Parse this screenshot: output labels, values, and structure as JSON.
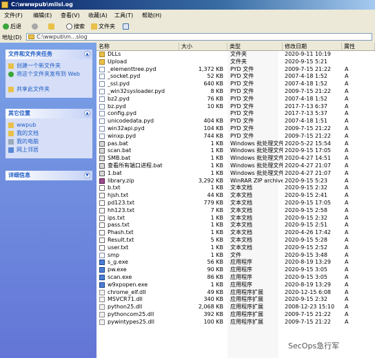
{
  "window": {
    "title": "C:\\wwwpub\\miisl.og"
  },
  "menu": [
    "文件(F)",
    "编辑(E)",
    "查看(V)",
    "收藏(A)",
    "工具(T)",
    "帮助(H)"
  ],
  "toolbar": {
    "back": "后退",
    "search": "搜索",
    "folders": "文件夹"
  },
  "address": {
    "label": "地址(D)",
    "value": "C:\\wwpub\\m...slog"
  },
  "left": {
    "tasks": {
      "title": "文件和文件夹任务",
      "items": [
        "创建一个新文件夹",
        "将这个文件夹发布到 Web",
        "共享此文件夹"
      ]
    },
    "places": {
      "title": "其它位置",
      "items": [
        "wwpub",
        "我的文档",
        "我的电脑",
        "网上邻居"
      ]
    },
    "details": {
      "title": "详细信息"
    }
  },
  "columns": [
    "名称",
    "大小",
    "类型",
    "修改日期",
    "属性"
  ],
  "files": [
    {
      "name": "DLLs",
      "size": "",
      "type": "文件夹",
      "date": "2020-9-11 10:19",
      "attr": "",
      "icon": "folder"
    },
    {
      "name": "Upload",
      "size": "",
      "type": "文件夹",
      "date": "2020-9-15 5:21",
      "attr": "",
      "icon": "folder"
    },
    {
      "name": "_elementtree.pyd",
      "size": "1,372 KB",
      "type": "PYD 文件",
      "date": "2009-7-15 21:22",
      "attr": "A",
      "icon": "file"
    },
    {
      "name": "_socket.pyd",
      "size": "52 KB",
      "type": "PYD 文件",
      "date": "2007-4-18 1:52",
      "attr": "A",
      "icon": "file"
    },
    {
      "name": "_ssl.pyd",
      "size": "640 KB",
      "type": "PYD 文件",
      "date": "2007-4-18 1:52",
      "attr": "A",
      "icon": "file"
    },
    {
      "name": "_win32sysloader.pyd",
      "size": "8 KB",
      "type": "PYD 文件",
      "date": "2009-7-15 21:22",
      "attr": "A",
      "icon": "file"
    },
    {
      "name": "bz2.pyd",
      "size": "76 KB",
      "type": "PYD 文件",
      "date": "2007-4-18 1:52",
      "attr": "A",
      "icon": "file"
    },
    {
      "name": "bz.pyd",
      "size": "10 KB",
      "type": "PYD 文件",
      "date": "2017-7-13 6:37",
      "attr": "A",
      "icon": "file"
    },
    {
      "name": "config.pyd",
      "size": "",
      "type": "PYD 文件",
      "date": "2017-7-13 5:37",
      "attr": "A",
      "icon": "file"
    },
    {
      "name": "unicodedata.pyd",
      "size": "404 KB",
      "type": "PYD 文件",
      "date": "2007-4-18 1:51",
      "attr": "A",
      "icon": "file"
    },
    {
      "name": "win32api.pyd",
      "size": "104 KB",
      "type": "PYD 文件",
      "date": "2009-7-15 21:22",
      "attr": "A",
      "icon": "file"
    },
    {
      "name": "winxp.pyd",
      "size": "744 KB",
      "type": "PYD 文件",
      "date": "2009-7-15 21:22",
      "attr": "A",
      "icon": "file"
    },
    {
      "name": "pas.bat",
      "size": "1 KB",
      "type": "Windows 批处理文件",
      "date": "2020-5-22 15:54",
      "attr": "A",
      "icon": "bat"
    },
    {
      "name": "scan.bat",
      "size": "1 KB",
      "type": "Windows 批处理文件",
      "date": "2020-9-15 17:05",
      "attr": "A",
      "icon": "bat"
    },
    {
      "name": "SMB.bat",
      "size": "1 KB",
      "type": "Windows 批处理文件",
      "date": "2020-4-27 14:51",
      "attr": "A",
      "icon": "bat"
    },
    {
      "name": "查看所有端口进程.bat",
      "size": "1 KB",
      "type": "Windows 批处理文件",
      "date": "2020-4-27 21:07",
      "attr": "A",
      "icon": "bat"
    },
    {
      "name": "1.bat",
      "size": "1 KB",
      "type": "Windows 批处理文件",
      "date": "2020-4-27 21:07",
      "attr": "A",
      "icon": "bat"
    },
    {
      "name": "library.zip",
      "size": "3,292 KB",
      "type": "WinRAR ZIP archive",
      "date": "2020-9-15 5:23",
      "attr": "A",
      "icon": "rar"
    },
    {
      "name": "b.txt",
      "size": "1 KB",
      "type": "文本文档",
      "date": "2020-9-15 2:32",
      "attr": "A",
      "icon": "txt"
    },
    {
      "name": "hjsh.txt",
      "size": "44 KB",
      "type": "文本文档",
      "date": "2020-9-15 2:41",
      "attr": "A",
      "icon": "txt"
    },
    {
      "name": "pd123.txt",
      "size": "779 KB",
      "type": "文本文档",
      "date": "2020-9-15 17:05",
      "attr": "A",
      "icon": "txt"
    },
    {
      "name": "hh123.txt",
      "size": "7 KB",
      "type": "文本文档",
      "date": "2020-9-15 2:58",
      "attr": "A",
      "icon": "txt"
    },
    {
      "name": "ips.txt",
      "size": "1 KB",
      "type": "文本文档",
      "date": "2020-9-15 2:32",
      "attr": "A",
      "icon": "txt"
    },
    {
      "name": "pass.txt",
      "size": "1 KB",
      "type": "文本文档",
      "date": "2020-9-15 2:51",
      "attr": "A",
      "icon": "txt"
    },
    {
      "name": "Phash.txt",
      "size": "1 KB",
      "type": "文本文档",
      "date": "2020-4-26 17:42",
      "attr": "A",
      "icon": "txt"
    },
    {
      "name": "Result.txt",
      "size": "5 KB",
      "type": "文本文档",
      "date": "2020-9-15 5:28",
      "attr": "A",
      "icon": "txt"
    },
    {
      "name": "user.txt",
      "size": "1 KB",
      "type": "文本文档",
      "date": "2020-9-15 2:52",
      "attr": "A",
      "icon": "txt"
    },
    {
      "name": "smp",
      "size": "1 KB",
      "type": "文件",
      "date": "2020-9-15 3:48",
      "attr": "A",
      "icon": "file"
    },
    {
      "name": "s_g.exe",
      "size": "56 KB",
      "type": "应用程序",
      "date": "2020-8-19 13:29",
      "attr": "A",
      "icon": "exe"
    },
    {
      "name": "pw.exe",
      "size": "90 KB",
      "type": "应用程序",
      "date": "2020-9-15 3:05",
      "attr": "A",
      "icon": "exe"
    },
    {
      "name": "scan.exe",
      "size": "86 KB",
      "type": "应用程序",
      "date": "2020-9-15 3:05",
      "attr": "A",
      "icon": "exe"
    },
    {
      "name": "w9xpopen.exe",
      "size": "1 KB",
      "type": "应用程序",
      "date": "2020-8-19 13:29",
      "attr": "A",
      "icon": "exe"
    },
    {
      "name": "chrome_elf.dll",
      "size": "49 KB",
      "type": "应用程序扩展",
      "date": "2020-12-15 6:08",
      "attr": "A",
      "icon": "dll"
    },
    {
      "name": "MSVCR71.dll",
      "size": "340 KB",
      "type": "应用程序扩展",
      "date": "2020-9-15 2:32",
      "attr": "A",
      "icon": "dll"
    },
    {
      "name": "python25.dll",
      "size": "2,068 KB",
      "type": "应用程序扩展",
      "date": "2008-12-23 15:10",
      "attr": "A",
      "icon": "dll"
    },
    {
      "name": "pythoncom25.dll",
      "size": "392 KB",
      "type": "应用程序扩展",
      "date": "2009-7-15 21:22",
      "attr": "A",
      "icon": "dll"
    },
    {
      "name": "pywintypes25.dll",
      "size": "100 KB",
      "type": "应用程序扩展",
      "date": "2009-7-15 21:22",
      "attr": "A",
      "icon": "dll"
    }
  ],
  "watermark": "SecOps急行军"
}
